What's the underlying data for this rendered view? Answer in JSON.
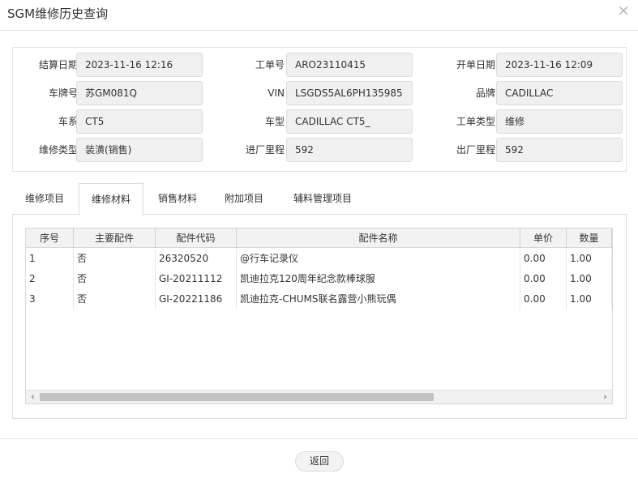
{
  "window": {
    "title": "SGM维修历史查询",
    "close_icon": "×"
  },
  "form": {
    "row1": [
      {
        "label": "结算日期",
        "value": "2023-11-16 12:16"
      },
      {
        "label": "工单号",
        "value": "ARO23110415"
      },
      {
        "label": "开单日期",
        "value": "2023-11-16 12:09"
      }
    ],
    "row2": [
      {
        "label": "车牌号",
        "value": "苏GM081Q"
      },
      {
        "label": "VIN",
        "value": "LSGDS5AL6PH135985"
      },
      {
        "label": "品牌",
        "value": "CADILLAC"
      }
    ],
    "row3": [
      {
        "label": "车系",
        "value": "CT5"
      },
      {
        "label": "车型",
        "value": "CADILLAC CT5_"
      },
      {
        "label": "工单类型",
        "value": "维修"
      }
    ],
    "row4": [
      {
        "label": "维修类型",
        "value": "装潢(销售)"
      },
      {
        "label": "进厂里程",
        "value": "592"
      },
      {
        "label": "出厂里程",
        "value": "592"
      }
    ]
  },
  "tabs": [
    {
      "label": "维修项目"
    },
    {
      "label": "维修材料",
      "active": true
    },
    {
      "label": "销售材料"
    },
    {
      "label": "附加项目"
    },
    {
      "label": "辅料管理项目"
    }
  ],
  "grid": {
    "columns": [
      "序号",
      "主要配件",
      "配件代码",
      "配件名称",
      "单价",
      "数量"
    ],
    "rows": [
      [
        "1",
        "否",
        "26320520",
        "@行车记录仪",
        "0.00",
        "1.00"
      ],
      [
        "2",
        "否",
        "GI-20211112",
        "凯迪拉克120周年纪念款棒球服",
        "0.00",
        "1.00"
      ],
      [
        "3",
        "否",
        "GI-20221186",
        "凯迪拉克-CHUMS联名露营小熊玩偶",
        "0.00",
        "1.00"
      ]
    ],
    "scroll_left_icon": "‹",
    "scroll_right_icon": "›"
  },
  "footer": {
    "back_label": "返回"
  }
}
